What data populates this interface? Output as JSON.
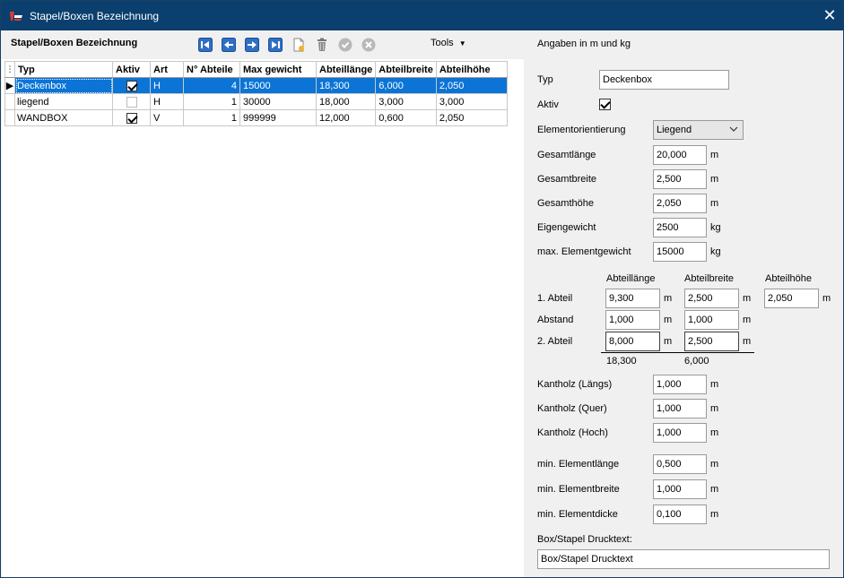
{
  "window": {
    "title": "Stapel/Boxen Bezeichnung"
  },
  "left": {
    "heading": "Stapel/Boxen Bezeichnung",
    "tools_label": "Tools",
    "columns": [
      "Typ",
      "Aktiv",
      "Art",
      "N° Abteile",
      "Max gewicht",
      "Abteillänge",
      "Abteilbreite",
      "Abteilhöhe"
    ],
    "rows": [
      {
        "typ": "Deckenbox",
        "aktiv": true,
        "art": "H",
        "abteile": "4",
        "max": "15000",
        "laenge": "18,300",
        "breite": "6,000",
        "hoehe": "2,050",
        "selected": true
      },
      {
        "typ": "liegend",
        "aktiv": false,
        "art": "H",
        "abteile": "1",
        "max": "30000",
        "laenge": "18,000",
        "breite": "3,000",
        "hoehe": "3,000",
        "selected": false
      },
      {
        "typ": "WANDBOX",
        "aktiv": true,
        "art": "V",
        "abteile": "1",
        "max": "999999",
        "laenge": "12,000",
        "breite": "0,600",
        "hoehe": "2,050",
        "selected": false
      }
    ]
  },
  "right": {
    "header": "Angaben in m und kg",
    "typ_label": "Typ",
    "typ_value": "Deckenbox",
    "aktiv_label": "Aktiv",
    "orient_label": "Elementorientierung",
    "orient_value": "Liegend",
    "gl_label": "Gesamtlänge",
    "gl_value": "20,000",
    "gb_label": "Gesamtbreite",
    "gb_value": "2,500",
    "gh_label": "Gesamthöhe",
    "gh_value": "2,050",
    "eg_label": "Eigengewicht",
    "eg_value": "2500",
    "meg_label": "max. Elementgewicht",
    "meg_value": "15000",
    "col_laenge": "Abteillänge",
    "col_breite": "Abteilbreite",
    "col_hoehe": "Abteilhöhe",
    "a1_label": "1. Abteil",
    "a1_l": "9,300",
    "a1_b": "2,500",
    "a1_h": "2,050",
    "ab_label": "Abstand",
    "ab_l": "1,000",
    "ab_b": "1,000",
    "a2_label": "2. Abteil",
    "a2_l": "8,000",
    "a2_b": "2,500",
    "sum_l": "18,300",
    "sum_b": "6,000",
    "kl_label": "Kantholz (Längs)",
    "kl_value": "1,000",
    "kq_label": "Kantholz (Quer)",
    "kq_value": "1,000",
    "kh_label": "Kantholz (Hoch)",
    "kh_value": "1,000",
    "mel_label": "min. Elementlänge",
    "mel_value": "0,500",
    "meb_label": "min. Elementbreite",
    "meb_value": "1,000",
    "med_label": "min. Elementdicke",
    "med_value": "0,100",
    "druck_label": "Box/Stapel Drucktext:",
    "druck_value": "Box/Stapel Drucktext",
    "unit_m": "m",
    "unit_kg": "kg"
  }
}
